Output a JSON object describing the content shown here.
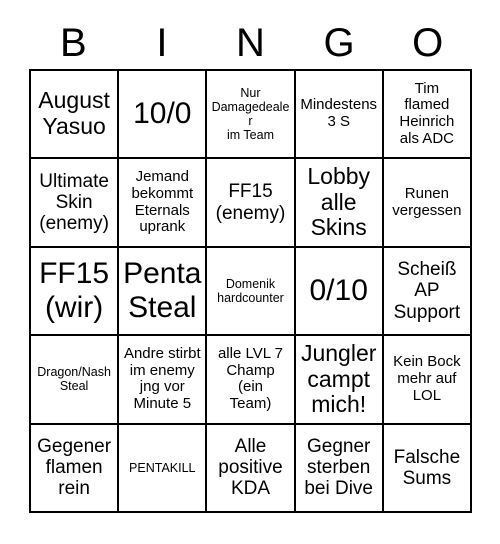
{
  "header": {
    "letters": [
      "B",
      "I",
      "N",
      "G",
      "O"
    ]
  },
  "grid": {
    "rows": 5,
    "columns": 5,
    "border_color": "#000000",
    "background_color": "#ffffff",
    "text_color": "#000000",
    "cells": [
      {
        "text": "August\nYasuo",
        "size": "lg"
      },
      {
        "text": "10/0",
        "size": "xl"
      },
      {
        "text": "Nur\nDamagedealer\nim Team",
        "size": "xs"
      },
      {
        "text": "Mindestens\n3 S",
        "size": "sm"
      },
      {
        "text": "Tim\nflamed\nHeinrich\nals ADC",
        "size": "sm"
      },
      {
        "text": "Ultimate\nSkin\n(enemy)",
        "size": "md"
      },
      {
        "text": "Jemand\nbekommt\nEternals\nuprank",
        "size": "sm"
      },
      {
        "text": "FF15\n(enemy)",
        "size": "md"
      },
      {
        "text": "Lobby\nalle\nSkins",
        "size": "lg"
      },
      {
        "text": "Runen\nvergessen",
        "size": "sm"
      },
      {
        "text": "FF15\n(wir)",
        "size": "xl"
      },
      {
        "text": "Penta\nSteal",
        "size": "xl"
      },
      {
        "text": "Domenik\nhardcounter",
        "size": "xs"
      },
      {
        "text": "0/10",
        "size": "xl"
      },
      {
        "text": "Scheiß\nAP\nSupport",
        "size": "md"
      },
      {
        "text": "Dragon/Nash\nSteal",
        "size": "xs"
      },
      {
        "text": "Andre stirbt\nim enemy\njng vor\nMinute 5",
        "size": "sm"
      },
      {
        "text": "alle LVL 7\nChamp\n(ein\nTeam)",
        "size": "sm"
      },
      {
        "text": "Jungler\ncampt\nmich!",
        "size": "lg"
      },
      {
        "text": "Kein Bock\nmehr auf\nLOL",
        "size": "sm"
      },
      {
        "text": "Gegener\nflamen\nrein",
        "size": "md"
      },
      {
        "text": "PENTAKILL",
        "size": "xs"
      },
      {
        "text": "Alle\npositive\nKDA",
        "size": "md"
      },
      {
        "text": "Gegner\nsterben\nbei Dive",
        "size": "md"
      },
      {
        "text": "Falsche\nSums",
        "size": "md"
      }
    ]
  }
}
